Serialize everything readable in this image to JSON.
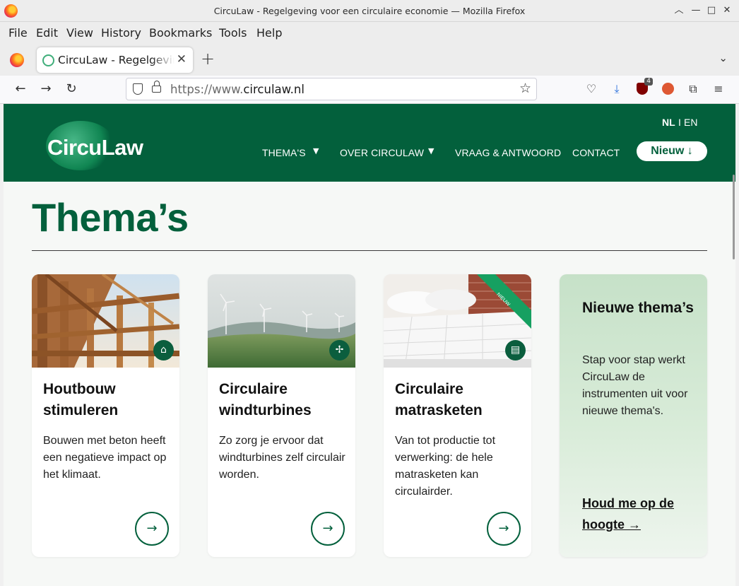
{
  "window": {
    "title": "CircuLaw - Regelgeving voor een circulaire economie — Mozilla Firefox"
  },
  "menu": [
    "File",
    "Edit",
    "View",
    "History",
    "Bookmarks",
    "Tools",
    "Help"
  ],
  "tab": {
    "title": "CircuLaw - Regelgeving voor een circulaire economie"
  },
  "url": {
    "prefix": "https://www.",
    "domain": "circulaw.nl"
  },
  "toolbar": {
    "extension_badge": "4"
  },
  "site": {
    "logo": "CircuLaw",
    "lang_nl": "NL",
    "lang_sep": "I",
    "lang_en": "EN",
    "nav": {
      "themas": "THEMA'S",
      "over": "OVER CIRCULAW",
      "faq": "VRAAG & ANTWOORD",
      "contact": "CONTACT",
      "nieuw": "Nieuw ↓"
    }
  },
  "page": {
    "heading": "Thema’s"
  },
  "cards": [
    {
      "title": "Houtbouw stimuleren",
      "text": "Bouwen met beton heeft een negatieve impact op het klimaat.",
      "icon": "house-frame-icon"
    },
    {
      "title": "Circulaire windturbines",
      "text": "Zo zorg je ervoor dat windturbines zelf circulair worden.",
      "icon": "wind-turbine-icon"
    },
    {
      "title": "Circulaire matrasketen",
      "text": "Van tot productie tot verwerking: de hele matrasketen kan circulairder.",
      "icon": "mattress-icon",
      "ribbon": "NIEUW"
    }
  ],
  "promo": {
    "title": "Nieuwe thema’s",
    "text": "Stap voor stap werkt CircuLaw de instrumenten uit voor nieuwe thema's.",
    "link": "Houd me op de hoogte →"
  },
  "colors": {
    "brand_green": "#03603c",
    "promo_green": "#c6e1c8",
    "ribbon_green": "#16a061"
  }
}
